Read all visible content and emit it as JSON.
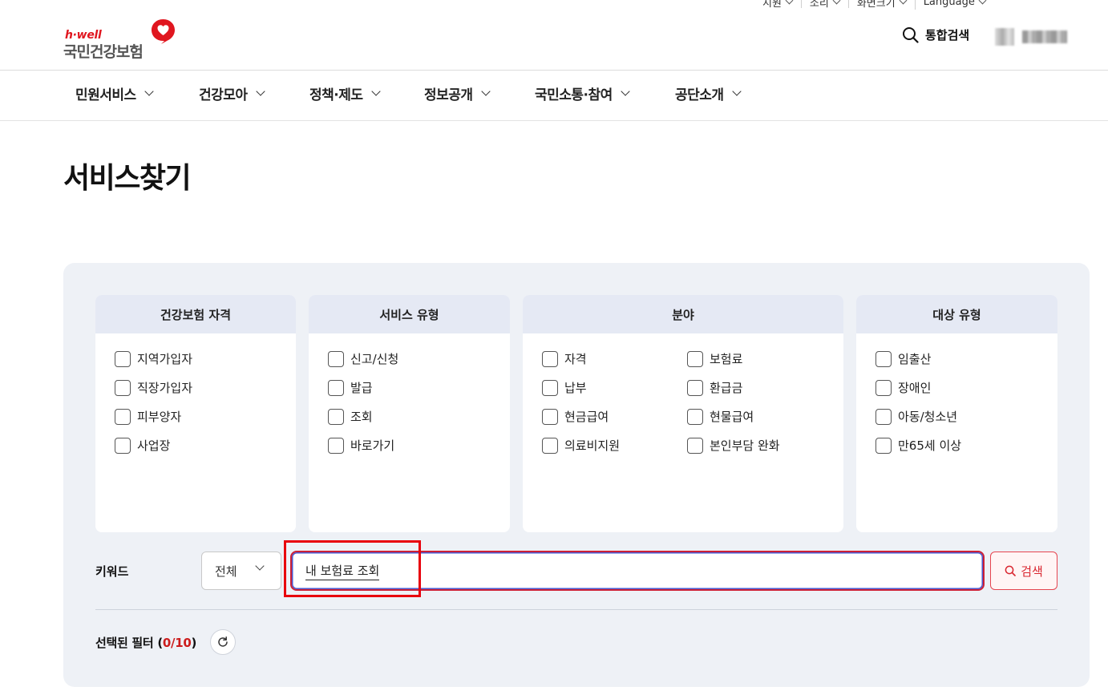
{
  "utility_bar": {
    "items": [
      "지원",
      "소리",
      "화면크기",
      "Language"
    ]
  },
  "header": {
    "logo_tagline": "h·well",
    "logo_name": "국민건강보험",
    "search_label": "통합검색"
  },
  "gnb": {
    "items": [
      "민원서비스",
      "건강모아",
      "정책·제도",
      "정보공개",
      "국민소통·참여",
      "공단소개"
    ]
  },
  "page_title": "서비스찾기",
  "filters": {
    "groups": [
      {
        "title": "건강보험 자격",
        "options": [
          "지역가입자",
          "직장가입자",
          "피부양자",
          "사업장"
        ]
      },
      {
        "title": "서비스 유형",
        "options": [
          "신고/신청",
          "발급",
          "조회",
          "바로가기"
        ]
      },
      {
        "title": "분야",
        "options": [
          "자격",
          "보험료",
          "납부",
          "환급금",
          "현금급여",
          "현물급여",
          "의료비지원",
          "본인부담 완화"
        ]
      },
      {
        "title": "대상 유형",
        "options": [
          "임출산",
          "장애인",
          "아동/청소년",
          "만65세 이상"
        ]
      }
    ]
  },
  "keyword": {
    "label": "키워드",
    "scope_selected": "전체",
    "value": "내 보험료 조회",
    "search_button": "검색"
  },
  "selected_filters": {
    "label": "선택된 필터",
    "count": "0/10"
  },
  "colors": {
    "brand_red": "#e0161f",
    "panel_bg": "#eef1f6",
    "box_header_bg": "#e5e9f4",
    "highlight_frame": "#e8000c"
  }
}
